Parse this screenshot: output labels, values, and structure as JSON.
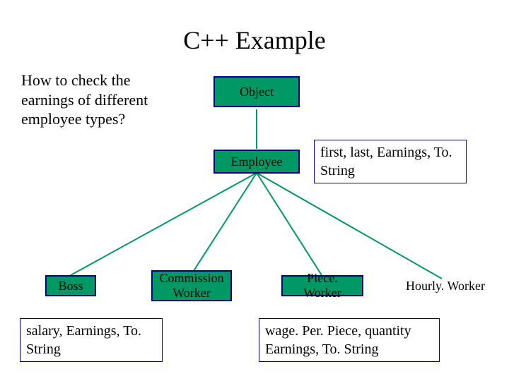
{
  "title": "C++ Example",
  "question": "How to check the earnings of different employee types?",
  "nodes": {
    "object": "Object",
    "employee": "Employee",
    "boss": "Boss",
    "commission": "Commission Worker",
    "piece": "Piece. Worker",
    "hourly": "Hourly. Worker"
  },
  "annotations": {
    "employee_members": "first, last, Earnings, To. String",
    "boss_members": "salary, Earnings, To. String",
    "piece_members": "wage. Per. Piece, quantity Earnings, To. String"
  }
}
